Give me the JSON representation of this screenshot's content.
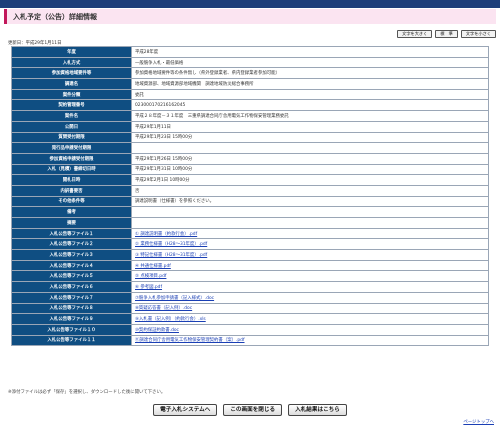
{
  "header": {
    "title": "入札予定（公告）詳細情報"
  },
  "font_buttons": {
    "large": "文字を大きく",
    "standard": "標　準",
    "small": "文字を小さく"
  },
  "updated": "更新日：平成29年1月11日",
  "rows": [
    {
      "label": "年度",
      "value": "平成28年度"
    },
    {
      "label": "入札方式",
      "value": "一般競争入札・最低価格"
    },
    {
      "label": "参加資格地域要件等",
      "value": "参加資格地域要件等の条件無し（県外登録業者、県内登録業者参加可能）"
    },
    {
      "label": "調達名",
      "value": "地域資源部、地域資源部地域機関　調達地域防災総合事務所"
    },
    {
      "label": "案件分類",
      "value": "委託"
    },
    {
      "label": "契約管理番号",
      "value": "023000170216162045"
    },
    {
      "label": "案件名",
      "value": "平成２８年度－３１年度　三重県調達合同庁舎用電気工作物保安管理業務委託"
    },
    {
      "label": "公開日",
      "value": "平成29年1月11日"
    },
    {
      "label": "質問受付期限",
      "value": "平成29年1月23日 15時00分"
    },
    {
      "label": "発行品申請受付期限",
      "value": ""
    },
    {
      "label": "参加資格申請受付期限",
      "value": "平成29年1月26日 15時00分"
    },
    {
      "label": "入札（見積）書締切日時",
      "value": "平成29年1月31日 10時00分"
    },
    {
      "label": "開札日時",
      "value": "平成29年2月1日 10時00分"
    },
    {
      "label": "内訳書要否",
      "value": "否"
    },
    {
      "label": "その他条件等",
      "value": "調達説明書（仕様書）を参照ください。"
    },
    {
      "label": "備考",
      "value": ""
    },
    {
      "label": "摘要",
      "value": ""
    }
  ],
  "files": [
    {
      "label": "入札公告等ファイル１",
      "file": "① 調達説明書（約款行会）.pdf"
    },
    {
      "label": "入札公告等ファイル２",
      "file": "② 業務仕様書（H28〜31年度）.pdf"
    },
    {
      "label": "入札公告等ファイル３",
      "file": "③ 特記仕様書（H28〜31年度）.pdf"
    },
    {
      "label": "入札公告等ファイル４",
      "file": "④ 共通仕様書.pdf"
    },
    {
      "label": "入札公告等ファイル５",
      "file": "⑤ 点検項目.pdf"
    },
    {
      "label": "入札公告等ファイル６",
      "file": "⑥ 参考図.pdf"
    },
    {
      "label": "入札公告等ファイル７",
      "file": "⑦競争入札参加申請書（記入様式）.doc"
    },
    {
      "label": "入札公告等ファイル８",
      "file": "⑧質疑応答書（記入例）.doc"
    },
    {
      "label": "入札公告等ファイル９",
      "file": "⑨入札書（記入例）（約款行会）.xls"
    },
    {
      "label": "入札公告等ファイル１０",
      "file": "⑩契約保証約款書.doc"
    },
    {
      "label": "入札公告等ファイル１１",
      "file": "⑪調達合同庁舎用電気工作物保安管理契約書（案）.pdf"
    }
  ],
  "note": "※添付ファイルは必ず「保存」を選択し、ダウンロードした後に開いて下さい。",
  "buttons": {
    "system": "電子入札システムへ",
    "close": "この画面を閉じる",
    "results": "入札結果はこちら"
  },
  "pagetop": "ページトップへ"
}
